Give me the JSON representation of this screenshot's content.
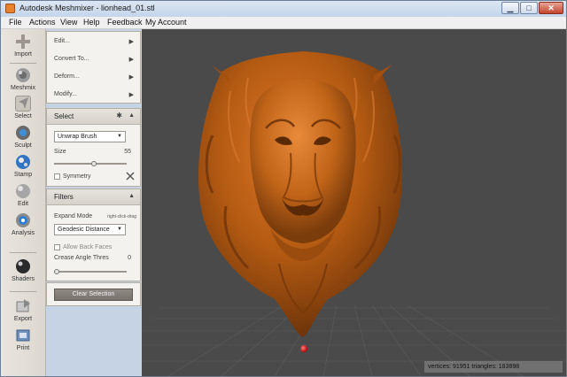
{
  "window": {
    "title": "Autodesk Meshmixer - lionhead_01.stl",
    "buttons": [
      "minimize",
      "maximize",
      "close"
    ]
  },
  "menubar": {
    "items": [
      "File",
      "Actions",
      "View",
      "Help",
      "Feedback",
      "My Account"
    ]
  },
  "toolbar": {
    "items": [
      {
        "label": "Import",
        "icon": "plus-icon"
      },
      {
        "label": "Meshmix",
        "icon": "meshmix-sphere-icon"
      },
      {
        "label": "Select",
        "icon": "select-arrow-icon",
        "active": true
      },
      {
        "label": "Sculpt",
        "icon": "sculpt-brush-icon"
      },
      {
        "label": "Stamp",
        "icon": "stamp-icon"
      },
      {
        "label": "Edit",
        "icon": "edit-sphere-icon"
      },
      {
        "label": "Analysis",
        "icon": "analysis-icon"
      },
      {
        "label": "Shaders",
        "icon": "shaders-sphere-icon"
      },
      {
        "label": "Export",
        "icon": "export-icon"
      },
      {
        "label": "Print",
        "icon": "print-icon"
      }
    ]
  },
  "actions_panel": {
    "items": [
      "Edit...",
      "Convert To...",
      "Deform...",
      "Modify..."
    ]
  },
  "select_panel": {
    "title": "Select",
    "brush": "Unwrap Brush",
    "size_label": "Size",
    "size_value": "55",
    "size_level": 0.55,
    "symmetry_label": "Symmetry"
  },
  "filters_panel": {
    "title": "Filters",
    "expand_mode_label": "Expand Mode",
    "expand_mode_hint": "right-click-drag",
    "expand_mode_value": "Geodesic Distance",
    "allow_back_faces_label": "Allow Back Faces",
    "crease_label": "Crease Angle Thres",
    "crease_value": "0",
    "crease_level": 0,
    "clear_button": "Clear Selection"
  },
  "viewport": {
    "model_color": "#b35a12",
    "background": "#4a4a4a"
  },
  "status": {
    "text": "vertices: 91951 triangles: 183898"
  }
}
